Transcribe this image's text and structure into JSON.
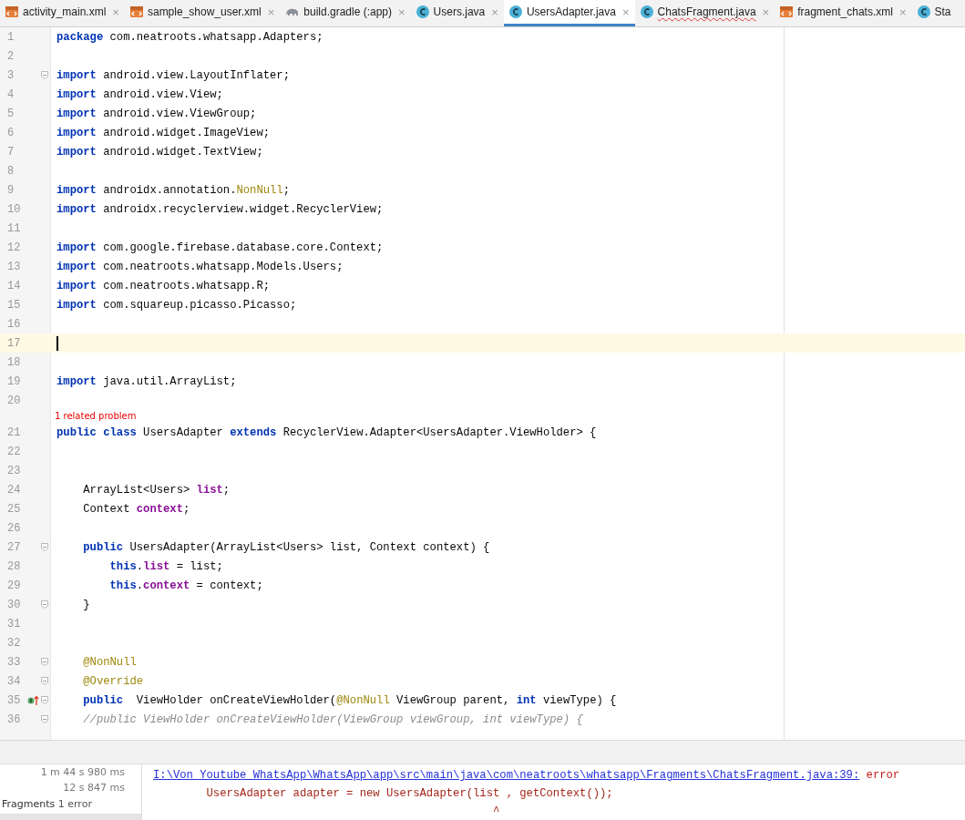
{
  "tabs": [
    {
      "label": "activity_main.xml",
      "kind": "xml",
      "selected": false,
      "error": false,
      "close": "×"
    },
    {
      "label": "sample_show_user.xml",
      "kind": "xml",
      "selected": false,
      "error": false,
      "close": "×"
    },
    {
      "label": "build.gradle (:app)",
      "kind": "gradle",
      "selected": false,
      "error": false,
      "close": "×"
    },
    {
      "label": "Users.java",
      "kind": "class",
      "selected": false,
      "error": false,
      "close": "×"
    },
    {
      "label": "UsersAdapter.java",
      "kind": "class",
      "selected": true,
      "error": false,
      "close": "×"
    },
    {
      "label": "ChatsFragment.java",
      "kind": "class",
      "selected": false,
      "error": true,
      "close": "×"
    },
    {
      "label": "fragment_chats.xml",
      "kind": "xml",
      "selected": false,
      "error": false,
      "close": "×"
    },
    {
      "label": "Sta",
      "kind": "class",
      "selected": false,
      "error": false
    }
  ],
  "editor": {
    "lines": [
      {
        "number": "1",
        "tokens": [
          {
            "kind": "keyword",
            "text": "package"
          },
          {
            "kind": "plain",
            "text": " com.neatroots.whatsapp.Adapters;"
          }
        ]
      },
      {
        "number": "2"
      },
      {
        "number": "3",
        "fold": true,
        "tokens": [
          {
            "kind": "keyword",
            "text": "import"
          },
          {
            "kind": "plain",
            "text": " android.view.LayoutInflater;"
          }
        ]
      },
      {
        "number": "4",
        "tokens": [
          {
            "kind": "keyword",
            "text": "import"
          },
          {
            "kind": "plain",
            "text": " android.view.View;"
          }
        ]
      },
      {
        "number": "5",
        "tokens": [
          {
            "kind": "keyword",
            "text": "import"
          },
          {
            "kind": "plain",
            "text": " android.view.ViewGroup;"
          }
        ]
      },
      {
        "number": "6",
        "tokens": [
          {
            "kind": "keyword",
            "text": "import"
          },
          {
            "kind": "plain",
            "text": " android.widget.ImageView;"
          }
        ]
      },
      {
        "number": "7",
        "tokens": [
          {
            "kind": "keyword",
            "text": "import"
          },
          {
            "kind": "plain",
            "text": " android.widget.TextView;"
          }
        ]
      },
      {
        "number": "8"
      },
      {
        "number": "9",
        "tokens": [
          {
            "kind": "keyword",
            "text": "import"
          },
          {
            "kind": "plain",
            "text": " androidx.annotation."
          },
          {
            "kind": "annotation",
            "text": "NonNull"
          },
          {
            "kind": "plain",
            "text": ";"
          }
        ]
      },
      {
        "number": "10",
        "tokens": [
          {
            "kind": "keyword",
            "text": "import"
          },
          {
            "kind": "plain",
            "text": " androidx.recyclerview.widget.RecyclerView;"
          }
        ]
      },
      {
        "number": "11"
      },
      {
        "number": "12",
        "tokens": [
          {
            "kind": "keyword",
            "text": "import"
          },
          {
            "kind": "plain",
            "text": " com.google.firebase.database.core.Context;"
          }
        ]
      },
      {
        "number": "13",
        "tokens": [
          {
            "kind": "keyword",
            "text": "import"
          },
          {
            "kind": "plain",
            "text": " com.neatroots.whatsapp.Models.Users;"
          }
        ]
      },
      {
        "number": "14",
        "tokens": [
          {
            "kind": "keyword",
            "text": "import"
          },
          {
            "kind": "plain",
            "text": " com.neatroots.whatsapp.R;"
          }
        ]
      },
      {
        "number": "15",
        "tokens": [
          {
            "kind": "keyword",
            "text": "import"
          },
          {
            "kind": "plain",
            "text": " com.squareup.picasso.Picasso;"
          }
        ]
      },
      {
        "number": "16"
      },
      {
        "number": "17",
        "current": true
      },
      {
        "number": "18"
      },
      {
        "number": "19",
        "tokens": [
          {
            "kind": "keyword",
            "text": "import"
          },
          {
            "kind": "plain",
            "text": " java.util.ArrayList;"
          }
        ]
      },
      {
        "number": "20"
      },
      {
        "number": "21",
        "inlay": "1 related problem",
        "tokens": [
          {
            "kind": "keyword",
            "text": "public class"
          },
          {
            "kind": "plain",
            "text": " UsersAdapter "
          },
          {
            "kind": "keyword",
            "text": "extends"
          },
          {
            "kind": "plain",
            "text": " RecyclerView.Adapter<UsersAdapter.ViewHolder> {"
          }
        ]
      },
      {
        "number": "22"
      },
      {
        "number": "23"
      },
      {
        "number": "24",
        "tokens": [
          {
            "kind": "plain",
            "text": "    ArrayList<Users> "
          },
          {
            "kind": "field",
            "text": "list"
          },
          {
            "kind": "plain",
            "text": ";"
          }
        ]
      },
      {
        "number": "25",
        "tokens": [
          {
            "kind": "plain",
            "text": "    Context "
          },
          {
            "kind": "field",
            "text": "context"
          },
          {
            "kind": "plain",
            "text": ";"
          }
        ]
      },
      {
        "number": "26"
      },
      {
        "number": "27",
        "fold": true,
        "tokens": [
          {
            "kind": "keyword",
            "text": "    public"
          },
          {
            "kind": "plain",
            "text": " UsersAdapter(ArrayList<Users> list, Context context) {"
          }
        ]
      },
      {
        "number": "28",
        "tokens": [
          {
            "kind": "keyword",
            "text": "        this"
          },
          {
            "kind": "plain",
            "text": "."
          },
          {
            "kind": "field",
            "text": "list"
          },
          {
            "kind": "plain",
            "text": " = list;"
          }
        ]
      },
      {
        "number": "29",
        "tokens": [
          {
            "kind": "keyword",
            "text": "        this"
          },
          {
            "kind": "plain",
            "text": "."
          },
          {
            "kind": "field",
            "text": "context"
          },
          {
            "kind": "plain",
            "text": " = context;"
          }
        ]
      },
      {
        "number": "30",
        "fold": true,
        "tokens": [
          {
            "kind": "plain",
            "text": "    }"
          }
        ]
      },
      {
        "number": "31"
      },
      {
        "number": "32"
      },
      {
        "number": "33",
        "fold": true,
        "tokens": [
          {
            "kind": "annotation",
            "text": "    @NonNull"
          }
        ]
      },
      {
        "number": "34",
        "fold": true,
        "tokens": [
          {
            "kind": "annotation",
            "text": "    @Override"
          }
        ]
      },
      {
        "number": "35",
        "fold": true,
        "gutter_mark": true,
        "tokens": [
          {
            "kind": "keyword",
            "text": "    public"
          },
          {
            "kind": "plain",
            "text": "  ViewHolder onCreateViewHolder("
          },
          {
            "kind": "annotation",
            "text": "@NonNull"
          },
          {
            "kind": "plain",
            "text": " ViewGroup parent, "
          },
          {
            "kind": "keyword",
            "text": "int"
          },
          {
            "kind": "plain",
            "text": " viewType) {"
          }
        ]
      },
      {
        "number": "36",
        "fold": true,
        "tokens": [
          {
            "kind": "comment",
            "text": "    //public ViewHolder onCreateViewHolder(ViewGroup viewGroup, int viewType) {"
          }
        ]
      }
    ]
  },
  "build_panel": {
    "tree": [
      {
        "text": "1 m 44 s 980 ms",
        "kind": "time"
      },
      {
        "text": "12 s 847 ms",
        "kind": "time"
      },
      {
        "text": "Fragments",
        "kind": "node",
        "count": "1 error"
      }
    ],
    "output": {
      "link": "I:\\Von Youtube WhatsApp\\WhatsApp\\app\\src\\main\\java\\com\\neatroots\\whatsapp\\Fragments\\ChatsFragment.java:39:",
      "level": "error",
      "lines": [
        "        UsersAdapter adapter = new UsersAdapter(list , getContext());",
        "                                                   ^"
      ]
    }
  }
}
